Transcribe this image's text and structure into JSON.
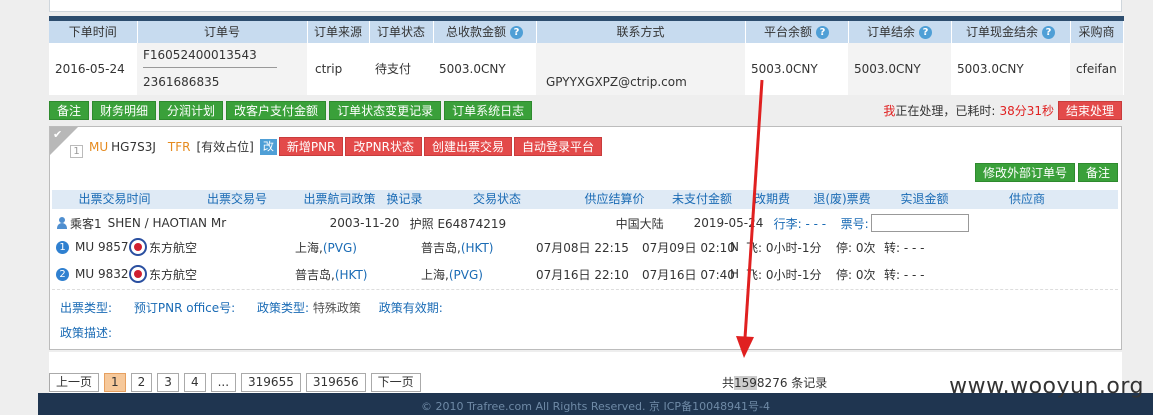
{
  "order_table": {
    "headers": [
      "下单时间",
      "订单号",
      "订单来源",
      "订单状态",
      "总收款金额",
      "联系方式",
      "平台余额",
      "订单结余",
      "订单现金结余",
      "采购商"
    ],
    "row": {
      "date": "2016-05-24",
      "order_no_1": "F16052400013543",
      "order_no_2": "2361686835",
      "source": "ctrip",
      "status": "待支付",
      "total": "5003.0CNY",
      "contact": "GPYYXGXPZ@ctrip.com",
      "platform_balance": "5003.0CNY",
      "order_balance": "5003.0CNY",
      "cash_balance": "5003.0CNY",
      "buyer": "cfeifan"
    },
    "help_icon": "?"
  },
  "action_buttons": [
    "备注",
    "财务明细",
    "分润计划",
    "改客户支付金额",
    "订单状态变更记录",
    "订单系统日志"
  ],
  "processing": {
    "who": "我",
    "text": "正在处理，已耗时:",
    "time": "38分31秒",
    "finish_button": "结束处理"
  },
  "pnr": {
    "index": "1",
    "airline": "MU",
    "code": "HG7S3J",
    "tag": "TFR",
    "status": "[有效占位]",
    "edit_chip": "改",
    "buttons": [
      "新增PNR",
      "改PNR状态",
      "创建出票交易",
      "自动登录平台"
    ],
    "right_buttons": [
      "修改外部订单号",
      "备注"
    ]
  },
  "ticket_header": [
    "出票交易时间",
    "出票交易号",
    "出票航司政策",
    "换记录",
    "交易状态",
    "供应结算价",
    "未支付金额",
    "改期费",
    "退(废)票费",
    "实退金额",
    "供应商"
  ],
  "passenger": {
    "label": "乘客1",
    "name": "SHEN / HAOTIAN Mr",
    "birth": "2003-11-20",
    "doc": "护照 E64874219",
    "nationality": "中国大陆",
    "expiry": "2019-05-24",
    "luggage": "行李: - - -",
    "ticket_label": "票号:"
  },
  "segments": [
    {
      "num": "1",
      "flight": "MU 9857",
      "airline": "东方航空",
      "from": "上海,",
      "from_code": "(PVG)",
      "to": "普吉岛,",
      "to_code": "(HKT)",
      "dep": "07月08日 22:15",
      "arr": "07月09日 02:10",
      "cabin": "N",
      "fly": "飞: 0小时-1分",
      "stop": "停: 0次",
      "transfer": "转: - - -"
    },
    {
      "num": "2",
      "flight": "MU 9832",
      "airline": "东方航空",
      "from": "普吉岛,",
      "from_code": "(HKT)",
      "to": "上海,",
      "to_code": "(PVG)",
      "dep": "07月16日 22:10",
      "arr": "07月16日 07:40",
      "cabin": "H",
      "fly": "飞: 0小时-1分",
      "stop": "停: 0次",
      "transfer": "转: - - -"
    }
  ],
  "meta": {
    "ticket_type": "出票类型:",
    "office": "预订PNR office号:",
    "policy_type": "政策类型:",
    "policy_value": "特殊政策",
    "policy_period": "政策有效期:",
    "policy_desc": "政策描述:"
  },
  "pager": {
    "prev": "上一页",
    "pages": [
      "1",
      "2",
      "3",
      "4",
      "...",
      "319655",
      "319656"
    ],
    "next": "下一页",
    "total_prefix": "共",
    "total_hl": "159",
    "total_rest": "8276",
    "total_suffix": "条记录"
  },
  "footer": "© 2010 Trafree.com All Rights Reserved. 京 ICP备10048941号-4",
  "watermark": "www.wooyun.org",
  "colors": {
    "header_bg": "#c7dbef",
    "green": "#3aa03a",
    "red": "#e34a4a",
    "arrow": "#e02020"
  }
}
